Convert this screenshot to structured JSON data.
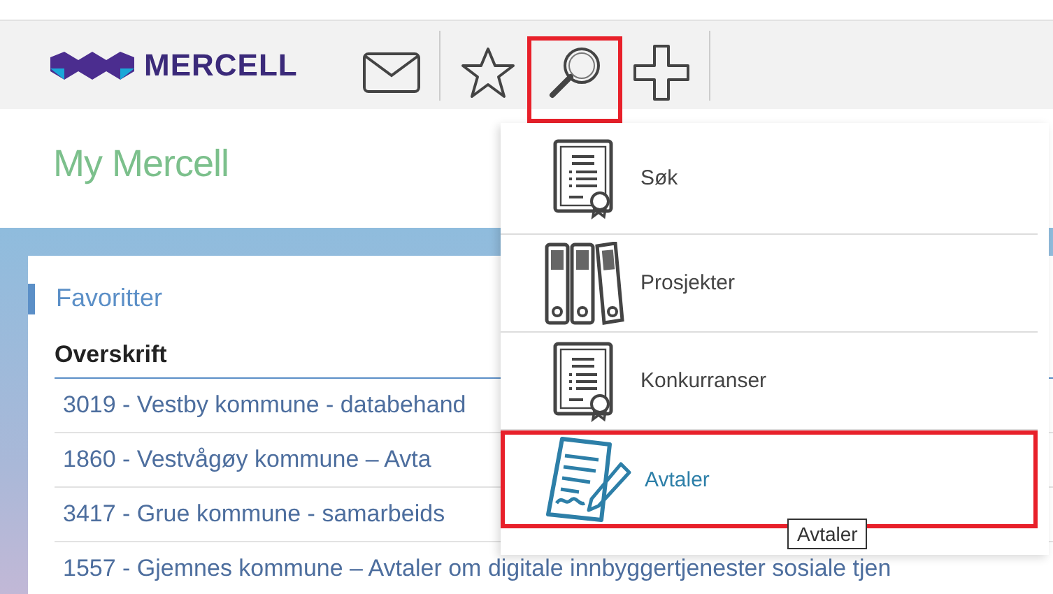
{
  "logo": {
    "text": "MERCELL"
  },
  "toolbar": [
    {
      "kind": "mail",
      "highlighted": false
    },
    {
      "kind": "star",
      "highlighted": false
    },
    {
      "kind": "search",
      "highlighted": true
    },
    {
      "kind": "plus",
      "highlighted": false
    }
  ],
  "page_title": "My Mercell",
  "favorites": {
    "title": "Favoritter",
    "column": "Overskrift",
    "rows": [
      "3019 - Vestby kommune - databehand",
      "1860 - Vestvågøy kommune – Avta",
      "3417 - Grue kommune - samarbeids",
      "1557 - Gjemnes kommune – Avtaler om digitale innbyggertjenester sosiale tjen"
    ]
  },
  "menu": {
    "items": [
      {
        "kind": "certificate",
        "label": "Søk",
        "selected": false,
        "highlighted": false
      },
      {
        "kind": "binders",
        "label": "Prosjekter",
        "selected": false,
        "highlighted": false
      },
      {
        "kind": "certificate",
        "label": "Konkurranser",
        "selected": false,
        "highlighted": false
      },
      {
        "kind": "contract",
        "label": "Avtaler",
        "selected": true,
        "highlighted": true
      }
    ]
  },
  "tooltip": "Avtaler"
}
